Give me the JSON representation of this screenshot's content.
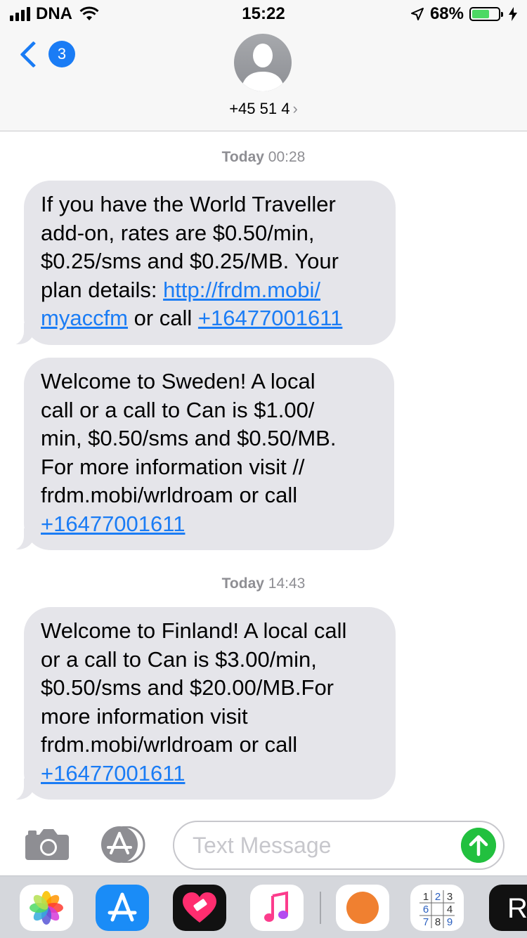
{
  "status_bar": {
    "carrier": "DNA",
    "time": "15:22",
    "battery_percent": "68%",
    "battery_level": 0.68,
    "icons": [
      "signal-icon",
      "wifi-icon",
      "location-arrow-icon",
      "battery-icon",
      "charging-bolt-icon"
    ]
  },
  "nav": {
    "back_badge": "3",
    "contact": "+45 51 4",
    "contact_chevron": "›"
  },
  "threads": [
    {
      "timestamp_day": "Today",
      "timestamp_time": "00:28"
    },
    {
      "timestamp_day": "Today",
      "timestamp_time": "14:43"
    }
  ],
  "messages": [
    {
      "line1": "If you have the World Traveller",
      "line2": "add-on, rates are $0.50/min,",
      "line3": "$0.25/sms and $0.25/MB. Your",
      "line4_text": "plan details: ",
      "line4_link": "http://frdm.mobi/",
      "line5_link": "myaccfm",
      "line5_text": " or call ",
      "line5_phone": "+16477001611"
    },
    {
      "line1": "Welcome to Sweden! A local",
      "line2": "call or a call to Can is $1.00/",
      "line3": "min, $0.50/sms and $0.50/MB.",
      "line4": "For more information visit //",
      "line5": "frdm.mobi/wrldroam or call",
      "line6_phone": "+16477001611"
    },
    {
      "line1": "Welcome to Finland! A local call",
      "line2": "or a call to Can is $3.00/min,",
      "line3": "$0.50/sms and $20.00/MB.For",
      "line4": "more information visit",
      "line5": "frdm.mobi/wrldroam or call",
      "line6_phone": "+16477001611"
    }
  ],
  "composer": {
    "placeholder": "Text Message"
  },
  "app_drawer": {
    "apps": [
      "photos-app-icon",
      "app-store-app-icon",
      "heart-app-icon",
      "music-app-icon",
      "orange-circle-app-icon",
      "sudoku-app-icon",
      "r-app-icon"
    ],
    "sudoku_digits": [
      "1",
      "2",
      "3",
      "6",
      "4",
      "7",
      "8",
      "9"
    ],
    "r_label": "R"
  },
  "colors": {
    "accent": "#1a7cf5",
    "bubble": "#e5e5ea",
    "send": "#22c03f",
    "battery": "#4cd964"
  }
}
